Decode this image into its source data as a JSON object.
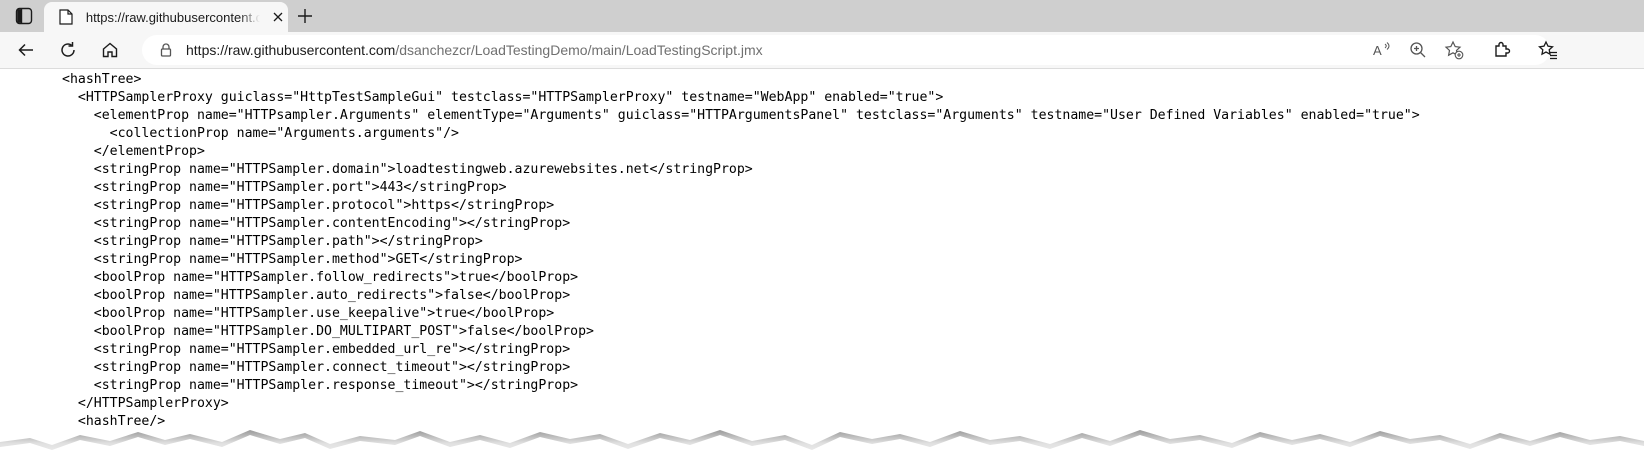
{
  "browser": {
    "tab": {
      "title": "https://raw.githubusercontent.com/dsanchezcr/LoadTestingDemo/main/LoadTestingScript.jmx"
    },
    "address": {
      "origin": "https://raw.githubusercontent.com",
      "path": "/dsanchezcr/LoadTestingDemo/main/LoadTestingScript.jmx"
    },
    "icons": {
      "tab_actions": "tab-actions-icon",
      "favicon": "page-icon",
      "close": "close-icon",
      "new_tab": "plus-icon",
      "back": "back-arrow-icon",
      "refresh": "refresh-icon",
      "home": "home-icon",
      "lock": "lock-icon",
      "read_aloud": "read-aloud-icon",
      "zoom": "zoom-icon",
      "favorite": "add-favorite-icon",
      "extensions": "extensions-icon",
      "favorites": "favorites-icon"
    }
  },
  "content": {
    "lines": [
      "<hashTree>",
      "  <HTTPSamplerProxy guiclass=\"HttpTestSampleGui\" testclass=\"HTTPSamplerProxy\" testname=\"WebApp\" enabled=\"true\">",
      "    <elementProp name=\"HTTPsampler.Arguments\" elementType=\"Arguments\" guiclass=\"HTTPArgumentsPanel\" testclass=\"Arguments\" testname=\"User Defined Variables\" enabled=\"true\">",
      "      <collectionProp name=\"Arguments.arguments\"/>",
      "    </elementProp>",
      "    <stringProp name=\"HTTPSampler.domain\">loadtestingweb.azurewebsites.net</stringProp>",
      "    <stringProp name=\"HTTPSampler.port\">443</stringProp>",
      "    <stringProp name=\"HTTPSampler.protocol\">https</stringProp>",
      "    <stringProp name=\"HTTPSampler.contentEncoding\"></stringProp>",
      "    <stringProp name=\"HTTPSampler.path\"></stringProp>",
      "    <stringProp name=\"HTTPSampler.method\">GET</stringProp>",
      "    <boolProp name=\"HTTPSampler.follow_redirects\">true</boolProp>",
      "    <boolProp name=\"HTTPSampler.auto_redirects\">false</boolProp>",
      "    <boolProp name=\"HTTPSampler.use_keepalive\">true</boolProp>",
      "    <boolProp name=\"HTTPSampler.DO_MULTIPART_POST\">false</boolProp>",
      "    <stringProp name=\"HTTPSampler.embedded_url_re\"></stringProp>",
      "    <stringProp name=\"HTTPSampler.connect_timeout\"></stringProp>",
      "    <stringProp name=\"HTTPSampler.response_timeout\"></stringProp>",
      "  </HTTPSamplerProxy>",
      "  <hashTree/>"
    ]
  }
}
